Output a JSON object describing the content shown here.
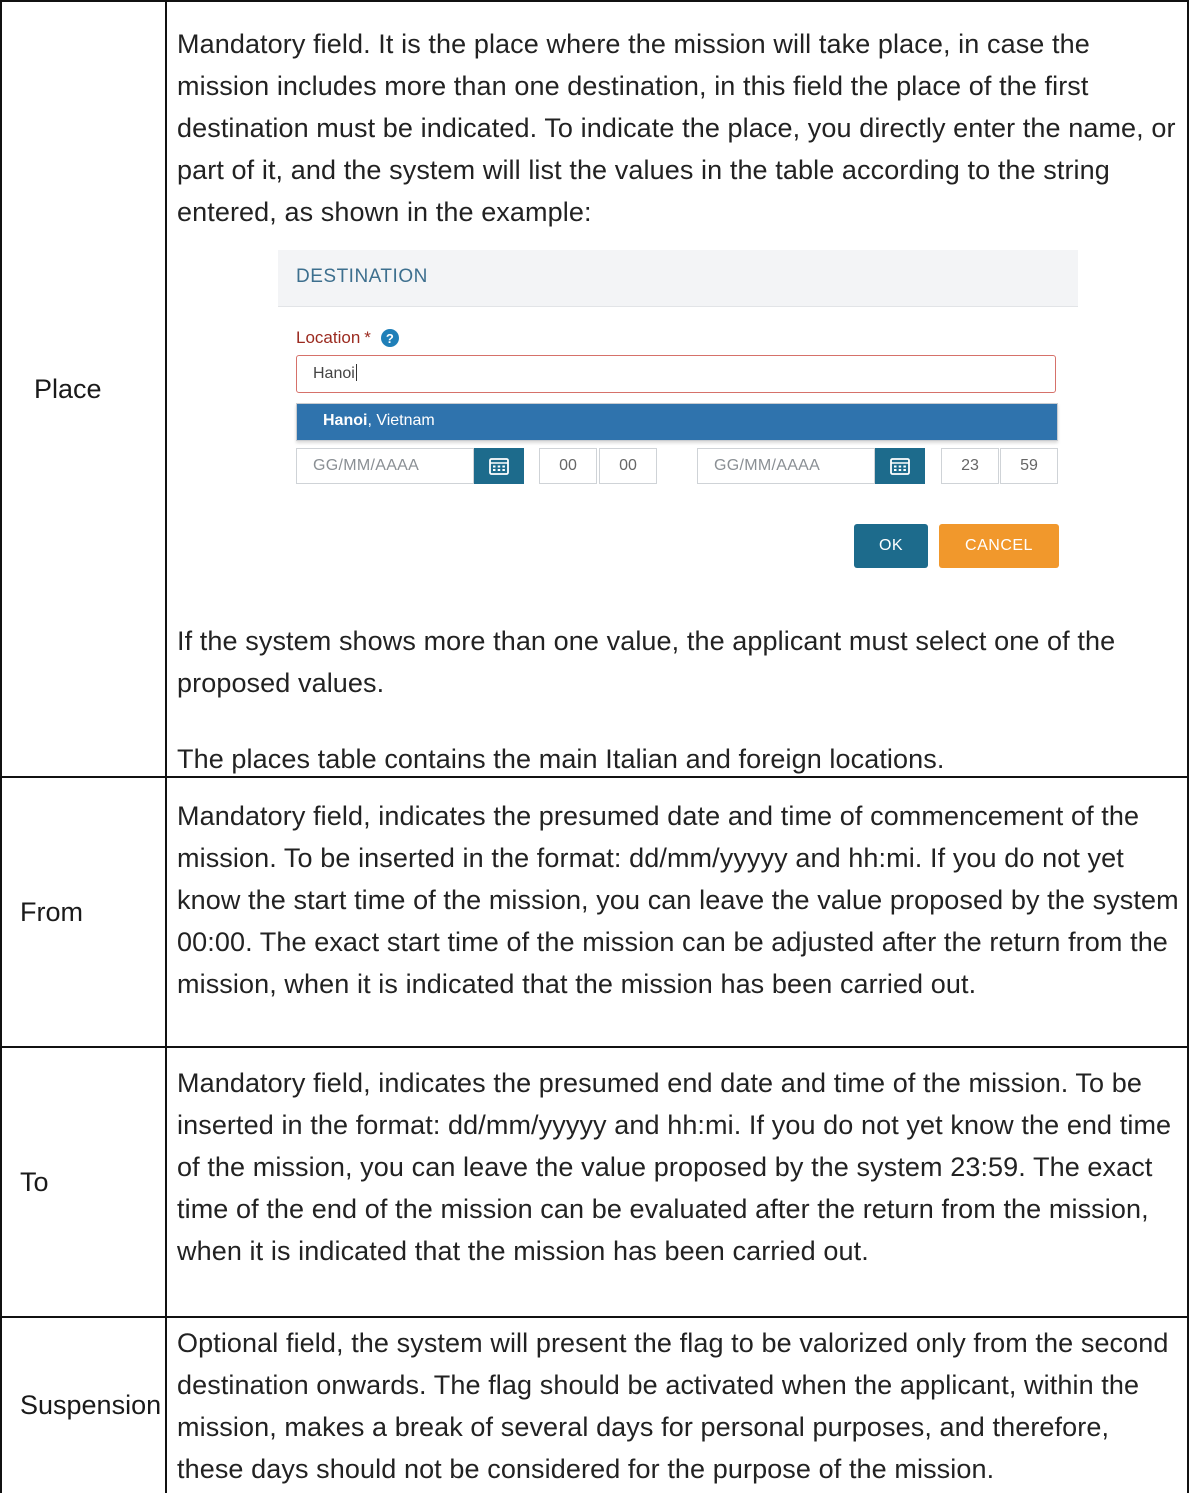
{
  "rows": [
    {
      "label": "Place",
      "paragraphs": [
        "Mandatory field. It is the place where the mission will take place, in case the mission includes more than one destination, in this field the place of the first destination must be indicated. To indicate the place, you directly enter the name, or part of it, and the system will list the values in the table according to the string entered, as shown in the example:",
        "If the system shows more than one value, the applicant must select one of the proposed values.",
        "The places table contains the main Italian and foreign locations."
      ]
    },
    {
      "label": "From",
      "text": "Mandatory field, indicates the presumed date and time of commencement of the mission. To be inserted in the format: dd/mm/yyyyy and hh:mi. If you do not yet know the start time of the mission, you can leave the value proposed by the system 00:00. The exact start time of the mission can be adjusted after the return from the mission, when it is indicated that the mission has been carried out."
    },
    {
      "label": "To",
      "text": "Mandatory field, indicates the presumed end date and time of the mission. To be inserted in the format: dd/mm/yyyyy and hh:mi. If you do not yet know the end time of the mission, you can leave the value proposed by the system 23:59. The exact time of the end of the mission can be evaluated after the return from the mission, when it is indicated that the mission has been carried out."
    },
    {
      "label": "Suspension",
      "text": "Optional field, the system will present the flag to be valorized only from the second destination onwards. The flag should be activated when the applicant, within the mission, makes a break of several days for personal purposes, and therefore, these days should not be considered for the purpose of the mission."
    }
  ],
  "screenshot": {
    "header": "DESTINATION",
    "location_label": "Location",
    "required_mark": "*",
    "help_icon": "?",
    "location_value": "Hanoi",
    "suggestion_bold": "Hanoi",
    "suggestion_rest": ", Vietnam",
    "from_date_placeholder": "GG/MM/AAAA",
    "from_hour": "00",
    "from_minute": "00",
    "to_date_placeholder": "GG/MM/AAAA",
    "to_hour": "23",
    "to_minute": "59",
    "time_separator": ":",
    "ok_label": "OK",
    "cancel_label": "CANCEL",
    "colors": {
      "primary": "#1d6b8c",
      "highlight": "#2f73ad",
      "cancel": "#f1982c",
      "required": "#9b2a1f"
    },
    "icons": [
      "help-icon",
      "calendar-icon"
    ]
  }
}
